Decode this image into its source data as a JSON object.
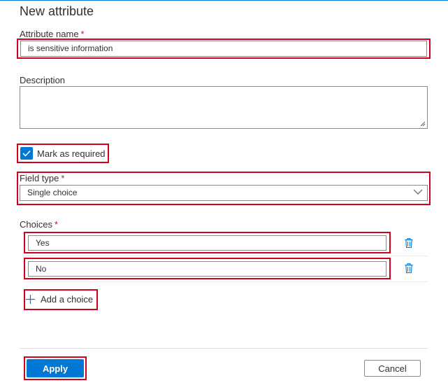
{
  "panel": {
    "title": "New attribute"
  },
  "form": {
    "attribute_name": {
      "label": "Attribute name",
      "required_mark": "*",
      "value": "is sensitive information"
    },
    "description": {
      "label": "Description",
      "value": ""
    },
    "mark_required": {
      "label": "Mark as required",
      "checked": true
    },
    "field_type": {
      "label": "Field type",
      "required_mark": "*",
      "selected": "Single choice"
    },
    "choices": {
      "label": "Choices",
      "required_mark": "*",
      "items": [
        {
          "value": "Yes"
        },
        {
          "value": "No"
        }
      ],
      "add_label": "Add a choice"
    }
  },
  "footer": {
    "apply_label": "Apply",
    "cancel_label": "Cancel"
  },
  "colors": {
    "accent": "#0078d4",
    "highlight": "#d0021b",
    "required": "#a4262c"
  },
  "icons": {
    "check": "checkmark-icon",
    "chevron": "chevron-down-icon",
    "trash": "trash-icon",
    "add": "plus-icon",
    "grip": "resize-grip-icon"
  }
}
